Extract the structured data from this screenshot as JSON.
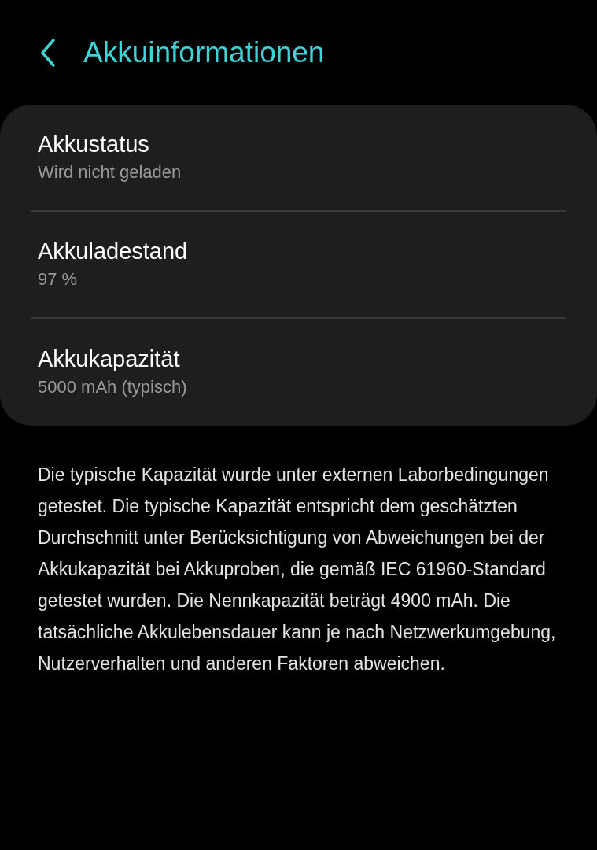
{
  "header": {
    "title": "Akkuinformationen"
  },
  "items": [
    {
      "title": "Akkustatus",
      "value": "Wird nicht geladen"
    },
    {
      "title": "Akkuladestand",
      "value": "97 %"
    },
    {
      "title": "Akkukapazität",
      "value": "5000 mAh (typisch)"
    }
  ],
  "description": "Die typische Kapazität wurde unter externen Laborbedingungen getestet. Die typische Kapazität entspricht dem geschätzten Durchschnitt unter Berücksichtigung von Abweichungen bei der Akkukapazität bei Akkuproben, die gemäß IEC 61960-Standard getestet wurden. Die Nennkapazität beträgt 4900 mAh. Die tatsächliche Akkulebensdauer kann je nach Netzwerkumgebung, Nutzerverhalten und anderen Faktoren abweichen."
}
